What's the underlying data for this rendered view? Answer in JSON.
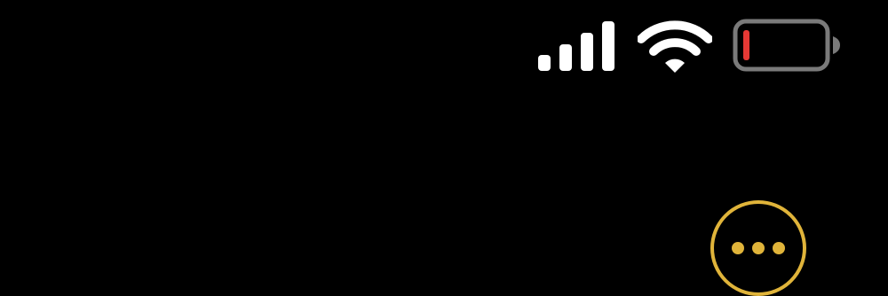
{
  "status_bar": {
    "signal": {
      "icon": "cellular-signal-icon",
      "bars_total": 4,
      "bars_filled": 4,
      "color": "#ffffff"
    },
    "wifi": {
      "icon": "wifi-icon",
      "color": "#ffffff"
    },
    "battery": {
      "icon": "battery-icon",
      "level": 0.08,
      "level_color": "#e53935",
      "outline_color": "#7a7a7a"
    }
  },
  "more_button": {
    "icon": "ellipsis-icon",
    "color": "#e0b43a"
  },
  "colors": {
    "background": "#000000",
    "accent": "#e0b43a"
  }
}
